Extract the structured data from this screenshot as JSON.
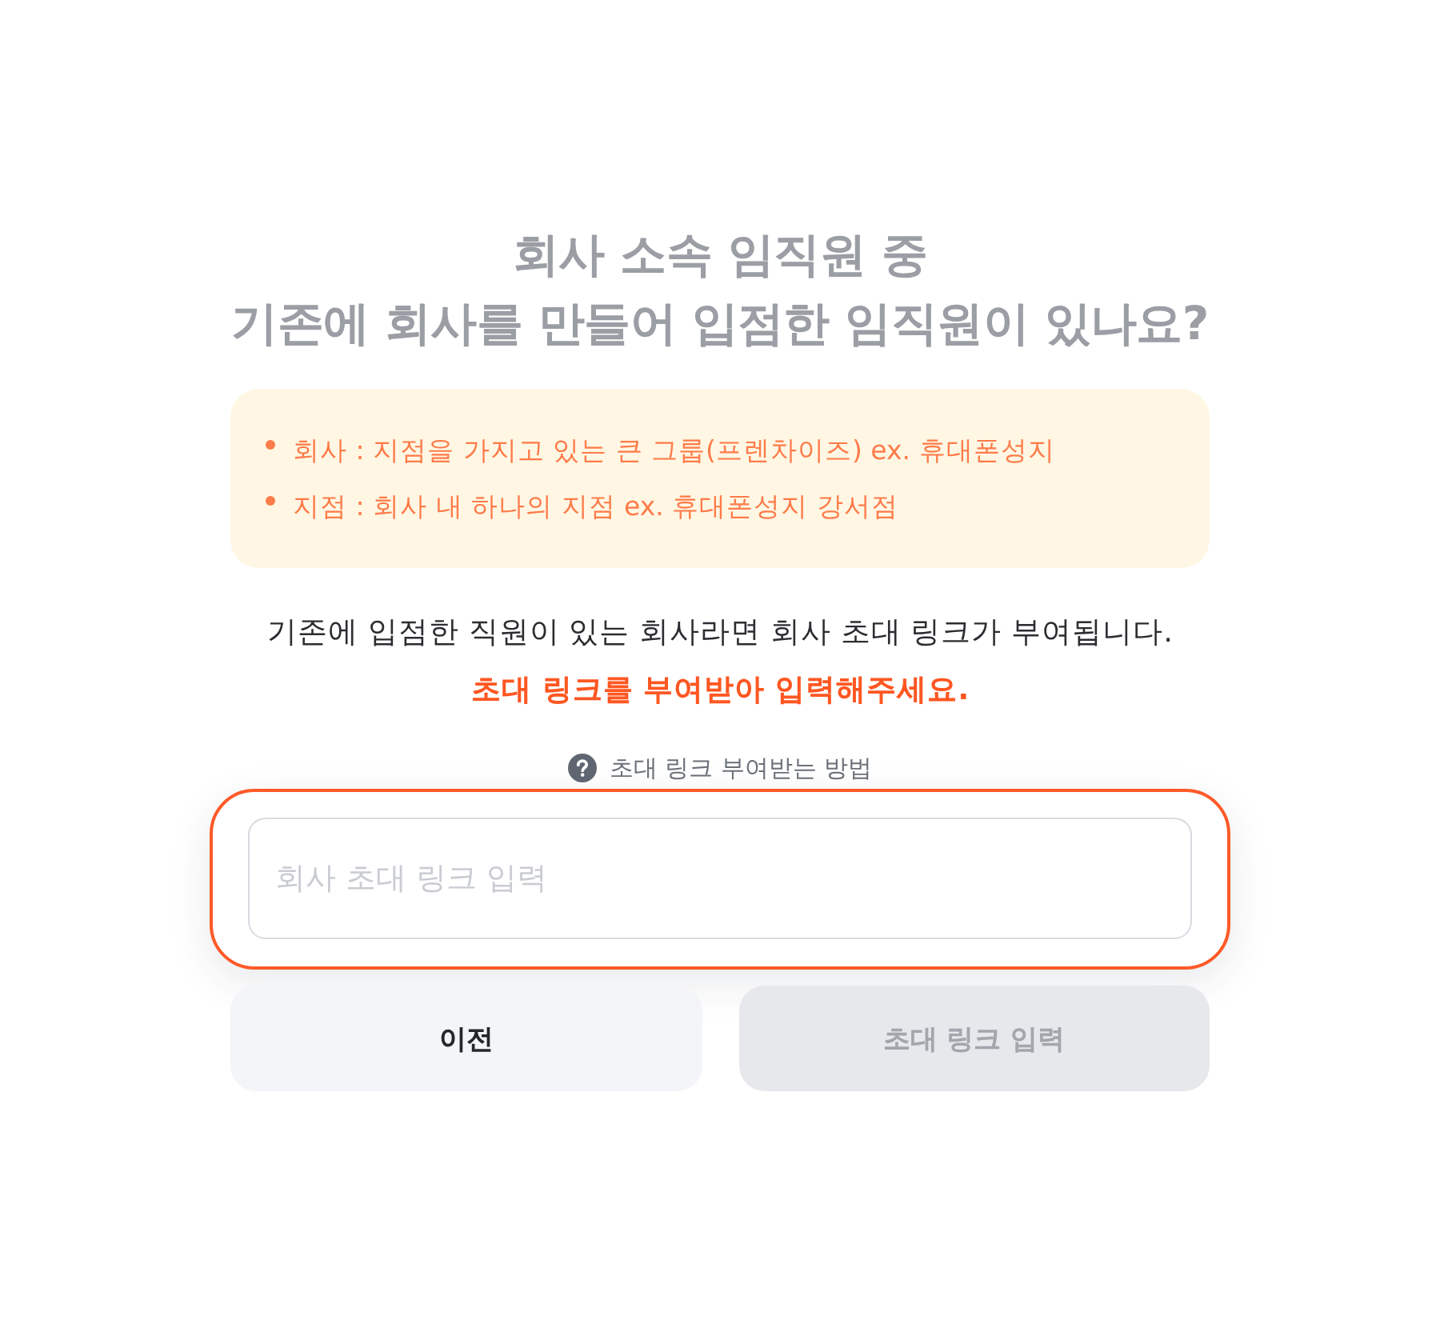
{
  "heading": {
    "lines": [
      "회사 소속 임직원 중",
      "기존에 회사를 만들어 입점한 임직원이 있나요?"
    ]
  },
  "info_box": {
    "items": [
      "회사 : 지점을 가지고 있는 큰 그룹(프렌차이즈) ex. 휴대폰성지",
      "지점 : 회사 내 하나의 지점 ex. 휴대폰성지 강서점"
    ]
  },
  "notice": {
    "text": "기존에 입점한 직원이 있는 회사라면 회사 초대 링크가 부여됩니다.",
    "emphasis": "초대 링크를 부여받아 입력해주세요."
  },
  "help_link": {
    "label": "초대 링크 부여받는 방법"
  },
  "input": {
    "placeholder": "회사 초대 링크 입력",
    "highlighted": true
  },
  "buttons": [
    {
      "label": "이전",
      "disabled": false
    },
    {
      "label": "초대 링크 입력",
      "disabled": true
    }
  ]
}
